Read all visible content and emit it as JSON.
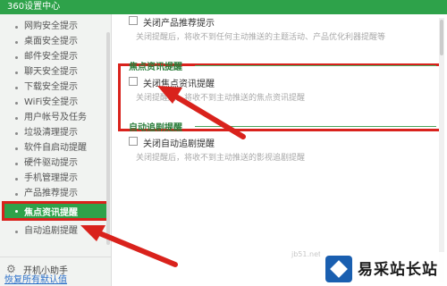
{
  "window": {
    "title": "360设置中心"
  },
  "sidebar": {
    "items": [
      {
        "label": "网购安全提示"
      },
      {
        "label": "桌面安全提示"
      },
      {
        "label": "邮件安全提示"
      },
      {
        "label": "聊天安全提示"
      },
      {
        "label": "下载安全提示"
      },
      {
        "label": "WiFi安全提示"
      },
      {
        "label": "用户帐号及任务"
      },
      {
        "label": "垃圾清理提示"
      },
      {
        "label": "软件自启动提醒"
      },
      {
        "label": "硬件驱动提示"
      },
      {
        "label": "手机管理提示"
      },
      {
        "label": "产品推荐提示"
      },
      {
        "label": "焦点资讯提醒",
        "active": true
      },
      {
        "label": "自动追剧提醒"
      }
    ],
    "helper_label": "开机小助手",
    "restore_label": "恢复所有默认值"
  },
  "content": {
    "product_option": {
      "label": "关闭产品推荐提示",
      "checked": false,
      "desc": "关闭提醒后，将收不到任何主动推送的主题活动、产品优化利器提醒等"
    },
    "focus_section": {
      "title": "焦点资讯提醒",
      "option_label": "关闭焦点资讯提醒",
      "checked": false,
      "desc": "关闭提醒后，将收不到主动推送的焦点资讯提醒"
    },
    "drama_section": {
      "title": "自动追剧提醒",
      "option_label": "关闭自动追剧提醒",
      "checked": false,
      "desc": "关闭提醒后，将收不到主动推送的影视追剧提醒"
    }
  },
  "watermark": {
    "text": "易采站长站",
    "faint": "jb51.net"
  },
  "colors": {
    "brand_green": "#2ea24a",
    "highlight_red": "#d9221c",
    "link_blue": "#2a6fc9"
  },
  "icons": {
    "helper": "gear-icon",
    "logo": "site-logo-icon"
  }
}
